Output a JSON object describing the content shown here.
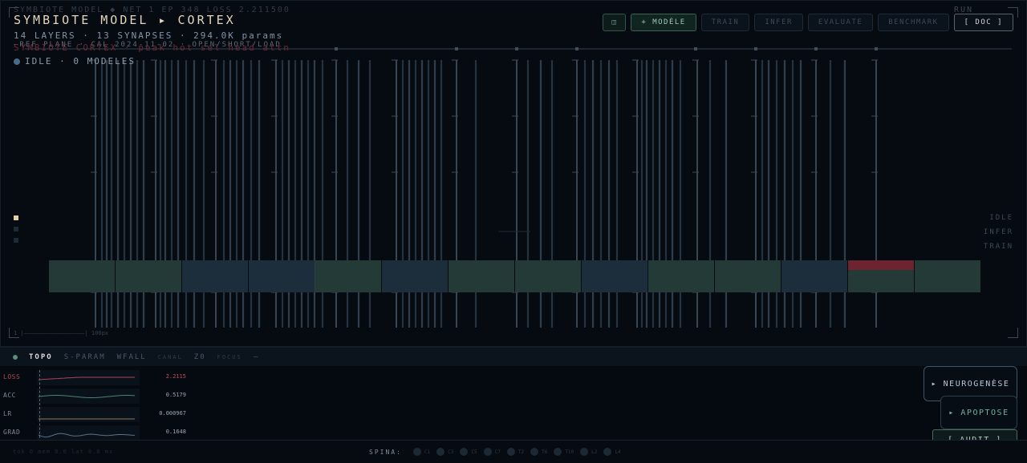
{
  "header": {
    "ghost_line": "SYMBIOTE MODEL  ◆  NET 1  EP 348  LOSS 2.211500",
    "ghost_right": "RUN",
    "title": "SYMBIOTE MODEL ▸ CORTEX",
    "subtitle": "14 LAYERS · 13 SYNAPSES · 294.0K params",
    "overlap_line_a": "—REF PLANE · CAL 2024-11-02 · OPEN/SHORT/LOAD",
    "overlap_line_b": "SYMBIOTE CORTEX · peak hot sel head attn",
    "status": "IDLE · 0 MODELES"
  },
  "toolbar": {
    "icon_label": "◫",
    "new_model": "+ MODÈLE",
    "train": "TRAIN",
    "infer": "INFER",
    "evaluate": "EVALUATE",
    "benchmark": "BENCHMARK",
    "doc": "[ DOC ]"
  },
  "modes": [
    "IDLE",
    "INFER",
    "TRAIN"
  ],
  "scale_label": "1 |——————————————————| 100px",
  "layers": [
    {
      "color": "#243a36"
    },
    {
      "color": "#243a36"
    },
    {
      "color": "#1c2e3c"
    },
    {
      "color": "#1c2e3c"
    },
    {
      "color": "#243a36"
    },
    {
      "color": "#1c2e3c"
    },
    {
      "color": "#243a36"
    },
    {
      "color": "#243a36"
    },
    {
      "color": "#1c2e3c"
    },
    {
      "color": "#243a36"
    },
    {
      "color": "#243a36"
    },
    {
      "color": "#1c2e3c"
    },
    {
      "color": "#243a36",
      "highlight": "#6e2430"
    },
    {
      "color": "#243a36"
    }
  ],
  "tabs": {
    "topo": "TOPO",
    "sparam": "S-PARAM",
    "wfall": "WFALL",
    "canal": "CANAL",
    "z0": "Z0",
    "focus": "FOCUS",
    "dash": "—"
  },
  "metrics": [
    {
      "label": "LOSS",
      "value": "2.2115",
      "color": "#b04553"
    },
    {
      "label": "ACC",
      "value": "0.5179",
      "color": "#4f8273"
    },
    {
      "label": "LR",
      "value": "0.000967",
      "color": "#8a7b62"
    },
    {
      "label": "GRAD",
      "value": "0.1648",
      "color": "#5b7186"
    }
  ],
  "panel_buttons": {
    "neurogenesis": "▸ NEUROGENÈSE",
    "apoptosis": "▸ APOPTOSE",
    "audit": "[ AUDIT ]"
  },
  "bottom": {
    "footer_ghost": "tok 0  mem 0.0  lat 0.0 ms",
    "spina_label": "SPINA:",
    "spina_segments": [
      "C1",
      "C3",
      "C5",
      "C7",
      "T2",
      "T6",
      "T10",
      "L2",
      "L4"
    ]
  },
  "colors": {
    "accent": "#e4d5bd",
    "green_layer": "#243a36",
    "blue_layer": "#1c2e3c",
    "alert": "#6e2430"
  }
}
